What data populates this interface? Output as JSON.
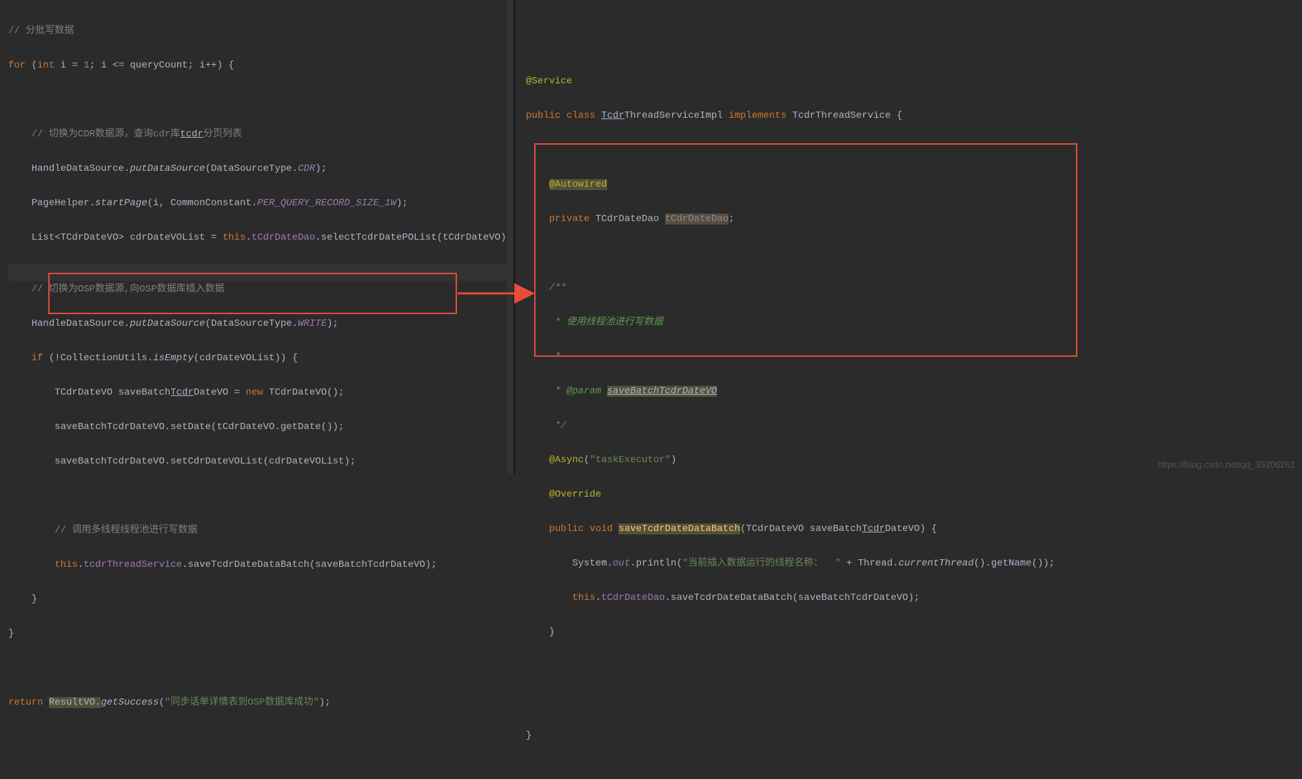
{
  "watermark": "https://blog.csdn.net/qq_35206261",
  "left": {
    "c_batch": "// 分批写数据",
    "kw_for": "for",
    "kw_int": "int",
    "var_i": "i",
    "eq1": "= ",
    "num1": "1",
    "le": "<=",
    "queryCount": "queryCount",
    "ipp": "i++",
    "c_switch_cdr": "// 切换为CDR数据源，查询cdr库",
    "tcdr_u": "tcdr",
    "c_switch_cdr2": "分页列表",
    "hds": "HandleDataSource.",
    "put_ds": "putDataSource",
    "dsType": "DataSourceType.",
    "cdr": "CDR",
    "ph": "PageHelper.",
    "startPage": "startPage",
    "cc": "CommonConstant.",
    "per": "PER_QUERY_RECORD_SIZE_1W",
    "listT": "List<TCdrDateVO> cdrDateVOList = ",
    "kw_this": "this",
    "dot": ".",
    "tcdrDateDao": "tCdrDateDao",
    "selectList": ".selectTcdrDatePOList(tCdrDateVO);",
    "c_switch_osp": "// 切换为OSP数据源,向OSP数据库插入数据",
    "write": "WRITE",
    "kw_if": "if",
    "collUtil": "(!CollectionUtils.",
    "isEmpty": "isEmpty",
    "cdl": "(cdrDateVOList)) {",
    "line_new": "TCdrDateVO saveBatch",
    "Tcdr_u": "Tcdr",
    "dateVO_eq": "DateVO = ",
    "kw_new": "new",
    "ctor": " TCdrDateVO();",
    "setDate": "saveBatchTcdrDateVO.setDate(tCdrDateVO.getDate());",
    "setList": "saveBatchTcdrDateVO.setCdrDateVOList(cdrDateVOList);",
    "c_pool": "// 调用多线程线程池进行写数据",
    "tts": "tcdrThreadService",
    "saveCall": ".saveTcdrDateDataBatch(saveBatchTcdrDateVO);",
    "rbrace": "}",
    "kw_return": "return",
    "resVO": "ResultVO.",
    "getSuccess": "getSuccess",
    "succStr": "\"同步话单详情表到OSP数据库成功\""
  },
  "right": {
    "svc": "@Service",
    "kw_pub": "public",
    "kw_class": "class",
    "clsName": "Tcdr",
    "clsRest": "ThreadServiceImpl",
    "kw_impl": "implements",
    "iface": "TcdrThreadService",
    "autow": "@Autowired",
    "kw_priv": "private",
    "daoType": "TCdrDateDao",
    "daoName": "tCdrDateDao",
    "doc1": "/**",
    "doc2": " * 使用线程池进行写数据",
    "doc3": " *",
    "doc_param": " * @param",
    "doc_pname": "saveBatchTcdrDateVO",
    "doc5": " */",
    "async": "@Async",
    "asyncArg": "\"taskExecutor\"",
    "override": "@Override",
    "kw_void": "void",
    "mname": "saveTcdrDateDataBatch",
    "mparamT": "TCdrDateVO",
    "mparamN": "saveBatch",
    "mparamN2": "Tcdr",
    "mparamN3": "DateVO",
    "sysout": "System.",
    "out": "out",
    "println": ".println(",
    "printStr": "\"当前插入数据运行的线程名称：  \"",
    "plus": " + Thread.",
    "curTh": "currentThread",
    "getName": "().getName());",
    "kw_this": "this",
    "daoField": "tCdrDateDao",
    "save2": ".saveTcdrDateDataBatch(saveBatchTcdrDateVO);"
  }
}
